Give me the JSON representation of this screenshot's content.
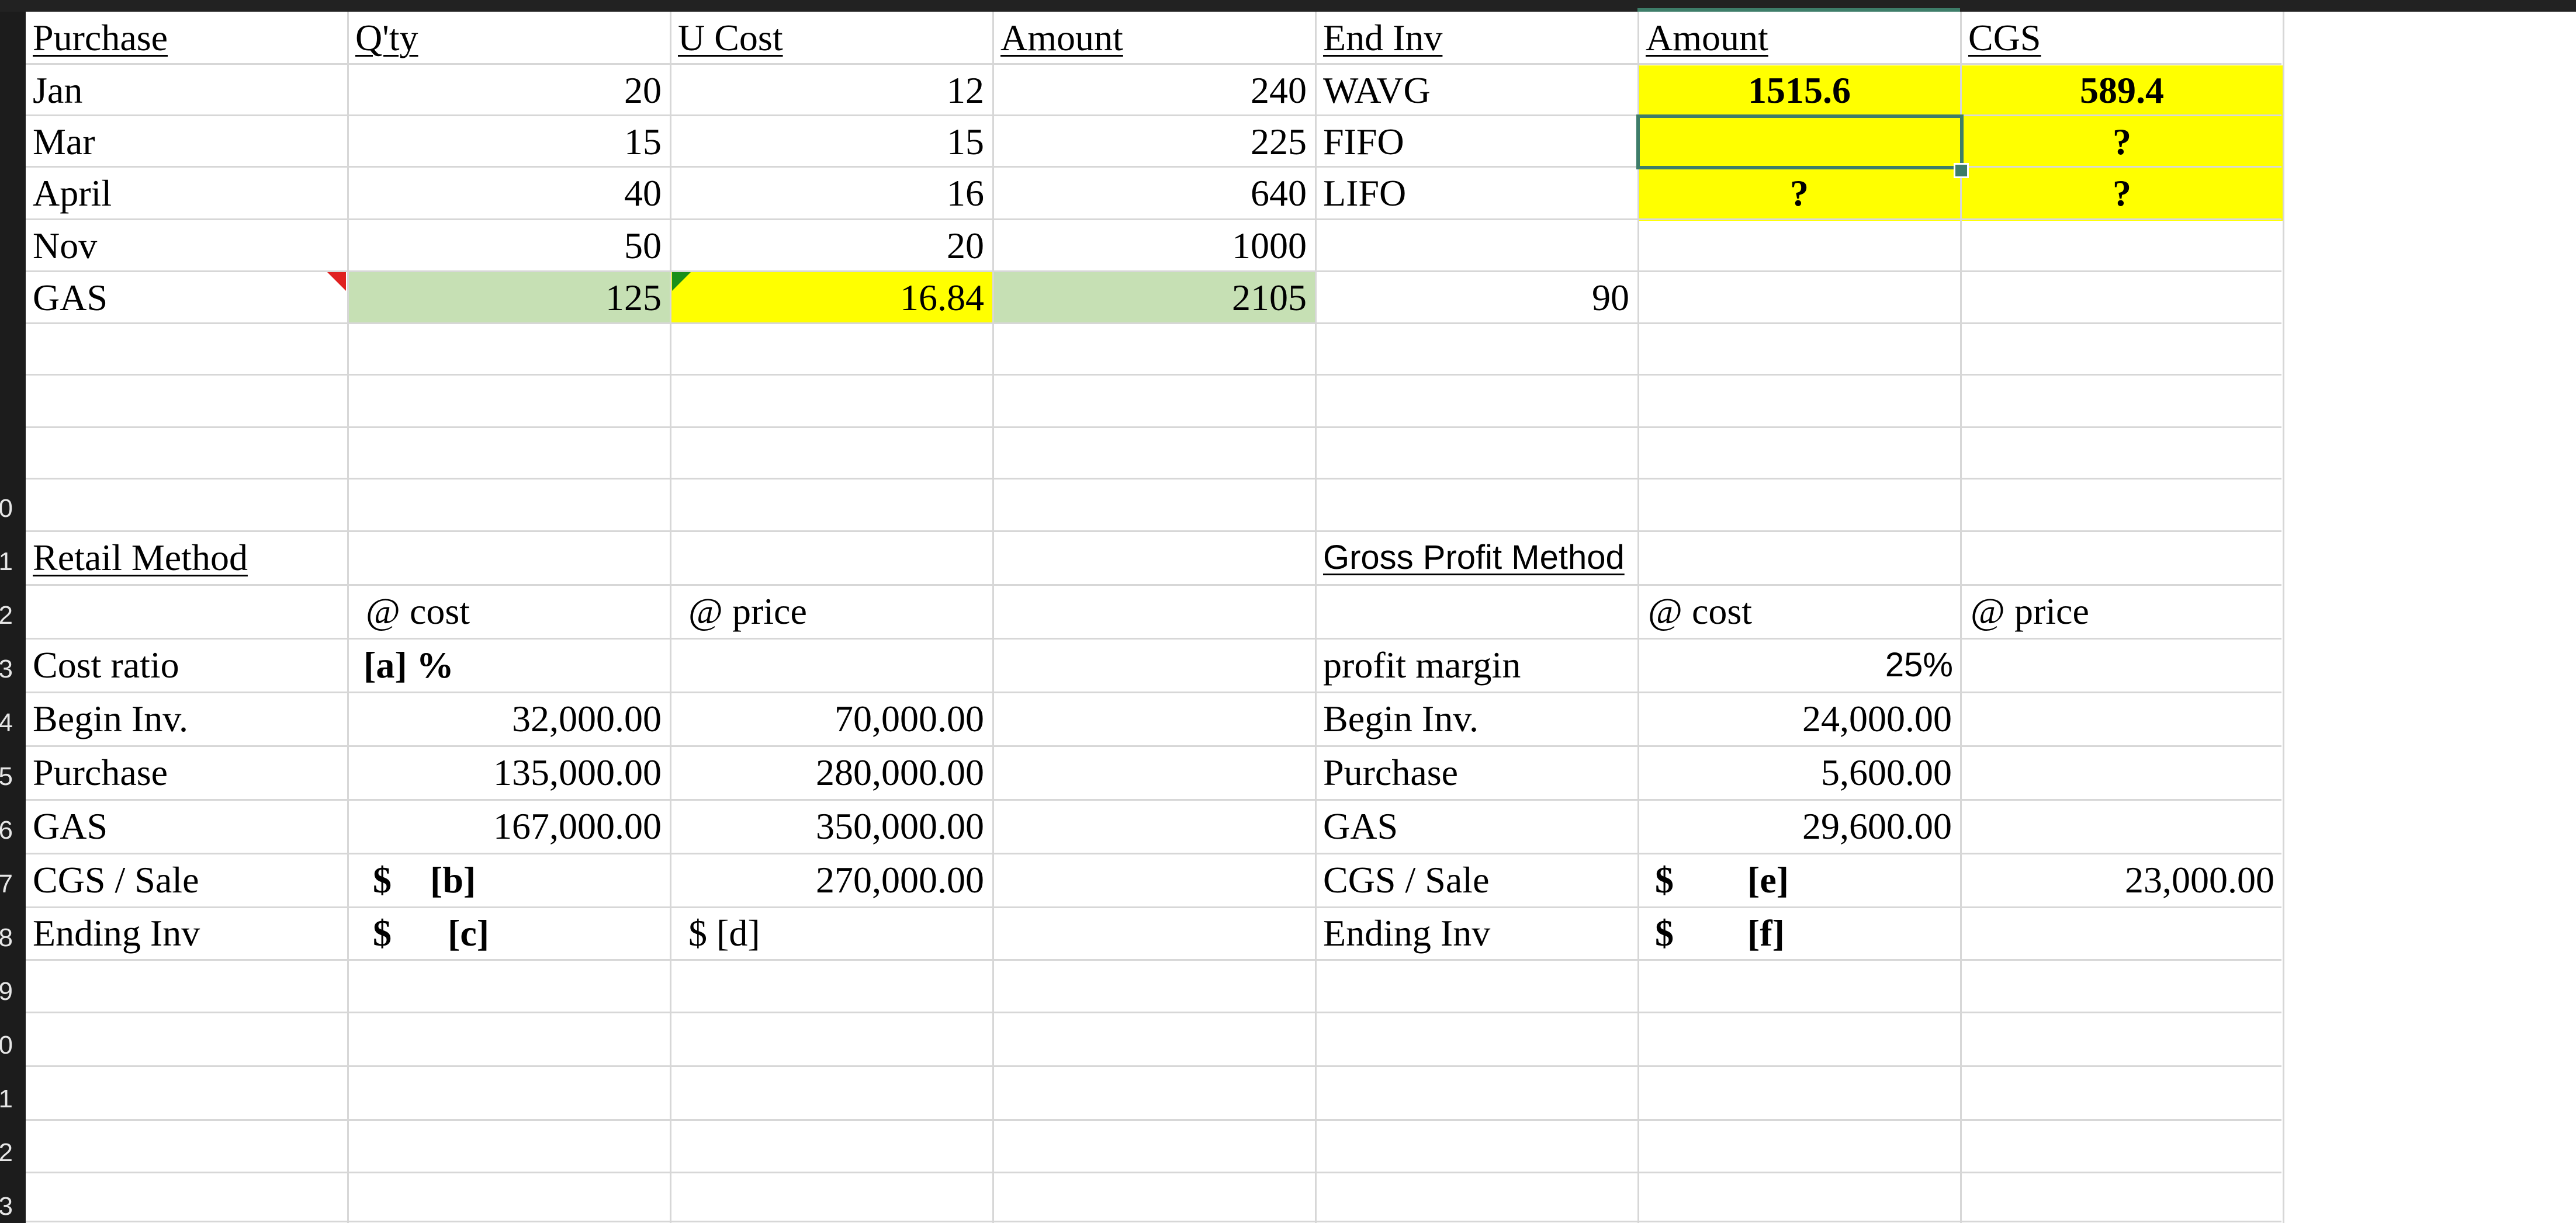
{
  "colors": {
    "yellow": "#ffff00",
    "green": "#c6e0b4",
    "selection": "#3e7d69",
    "comment_red": "#e02020",
    "error_green": "#1a8f1a"
  },
  "row_headers": [
    "0",
    "1",
    "2",
    "3",
    "4",
    "5",
    "6",
    "7",
    "8",
    "9",
    "0",
    "1",
    "2",
    "3"
  ],
  "headers": {
    "purchase": "Purchase",
    "qty": "Q'ty",
    "u_cost": "U Cost",
    "amount": "Amount",
    "end_inv": "End Inv",
    "amount2": "Amount",
    "cgs": "CGS"
  },
  "purchases": [
    {
      "label": "Jan",
      "qty": "20",
      "u_cost": "12",
      "amount": "240"
    },
    {
      "label": "Mar",
      "qty": "15",
      "u_cost": "15",
      "amount": "225"
    },
    {
      "label": "April",
      "qty": "40",
      "u_cost": "16",
      "amount": "640"
    },
    {
      "label": "Nov",
      "qty": "50",
      "u_cost": "20",
      "amount": "1000"
    },
    {
      "label": "GAS",
      "qty": "125",
      "u_cost": "16.84",
      "amount": "2105"
    }
  ],
  "end_inv_qty": "90",
  "methods": [
    {
      "label": "WAVG",
      "amount": "1515.6",
      "cgs": "589.4"
    },
    {
      "label": "FIFO",
      "amount": "",
      "cgs": "?"
    },
    {
      "label": "LIFO",
      "amount": "?",
      "cgs": "?"
    }
  ],
  "retail": {
    "title": "Retail Method",
    "cost_header": "@ cost",
    "price_header": "@ price",
    "rows": [
      {
        "label": "Cost ratio",
        "cost": "[a] %",
        "price": ""
      },
      {
        "label": "Begin Inv.",
        "cost": "32,000.00",
        "price": "70,000.00"
      },
      {
        "label": "Purchase",
        "cost": "135,000.00",
        "price": "280,000.00"
      },
      {
        "label": "GAS",
        "cost": "167,000.00",
        "price": "350,000.00"
      },
      {
        "label": "CGS / Sale",
        "cost_dollar": "$",
        "cost": "[b]",
        "price": "270,000.00"
      },
      {
        "label": "Ending Inv",
        "cost_dollar": "$",
        "cost": "[c]",
        "price": "$ [d]"
      }
    ]
  },
  "gross_profit": {
    "title": "Gross Profit Method",
    "cost_header": "@ cost",
    "price_header": "@ price",
    "rows": [
      {
        "label": "profit margin",
        "cost": "25%",
        "price": ""
      },
      {
        "label": "Begin Inv.",
        "cost": "24,000.00",
        "price": ""
      },
      {
        "label": "Purchase",
        "cost": "5,600.00",
        "price": ""
      },
      {
        "label": "GAS",
        "cost": "29,600.00",
        "price": ""
      },
      {
        "label": "CGS / Sale",
        "cost_dollar": "$",
        "cost": "[e]",
        "price": "23,000.00"
      },
      {
        "label": "Ending Inv",
        "cost_dollar": "$",
        "cost": "[f]",
        "price": ""
      }
    ]
  }
}
